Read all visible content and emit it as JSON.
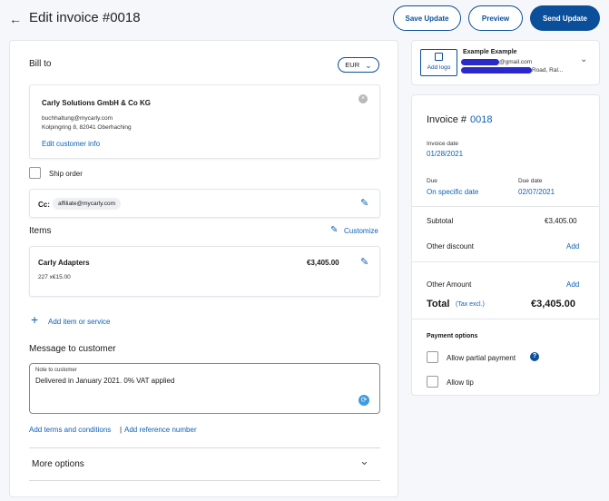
{
  "header": {
    "title": "Edit invoice #0018",
    "save_label": "Save Update",
    "preview_label": "Preview",
    "send_label": "Send Update"
  },
  "bill_to": {
    "heading": "Bill to",
    "currency": "EUR",
    "customer_name": "Carly Solutions GmbH & Co KG",
    "email": "buchhaltung@mycarly.com",
    "address": "Kolpingring 8, 82041 Oberhaching",
    "edit_link": "Edit customer info",
    "ship_order": "Ship order",
    "cc_label": "Cc:",
    "cc_email": "affiliate@mycarly.com"
  },
  "items": {
    "heading": "Items",
    "customize": "Customize",
    "list": [
      {
        "name": "Carly Adapters",
        "qty_price": "227 x€15.00",
        "amount": "€3,405.00"
      }
    ],
    "add_item": "Add item or service"
  },
  "message": {
    "heading": "Message to customer",
    "field_label": "Note to customer",
    "value": "Delivered in January 2021. 0% VAT applied",
    "add_terms": "Add terms and conditions",
    "separator": "|",
    "add_reference": "Add reference number"
  },
  "more_options": "More options",
  "business": {
    "add_logo": "Add logo",
    "name": "Example Example",
    "email_suffix": "@gmail.com",
    "address_suffix": "Road, Ral..."
  },
  "summary": {
    "invoice_label": "Invoice #",
    "invoice_number": "0018",
    "invoice_date_label": "Invoice date",
    "invoice_date": "01/28/2021",
    "due_label": "Due",
    "due_value": "On specific date",
    "due_date_label": "Due date",
    "due_date": "02/07/2021",
    "subtotal_label": "Subtotal",
    "subtotal": "€3,405.00",
    "discount_label": "Other discount",
    "discount_add": "Add",
    "other_amount_label": "Other Amount",
    "other_amount_add": "Add",
    "total_label": "Total",
    "tax_note": "(Tax excl.)",
    "total": "€3,405.00"
  },
  "payment": {
    "heading": "Payment options",
    "partial": "Allow partial payment",
    "tip": "Allow tip"
  },
  "colors": {
    "accent": "#0b4f9b",
    "link": "#0b61b8",
    "redaction": "#2a2acc"
  }
}
